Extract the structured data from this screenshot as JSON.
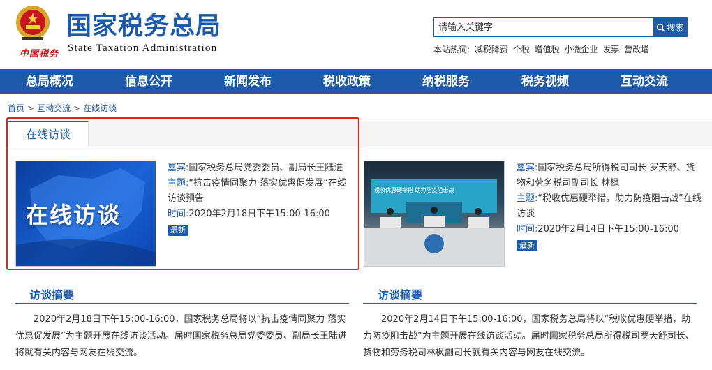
{
  "header": {
    "emblem_icon": "national-tax-emblem-icon",
    "china_tax_text": "中国税务",
    "title": "国家税务总局",
    "subtitle": "State Taxation Administration",
    "brand_color": "#1d5aa9"
  },
  "search": {
    "placeholder": "请输入关键字",
    "button_label": "搜索",
    "button_icon": "search-icon"
  },
  "hotwords": {
    "label": "本站热词:",
    "items": [
      "减税降费",
      "个税",
      "增值税",
      "小微企业",
      "发票",
      "营改增"
    ]
  },
  "nav": {
    "items": [
      "总局概况",
      "信息公开",
      "新闻发布",
      "税收政策",
      "纳税服务",
      "税务视频",
      "互动交流"
    ]
  },
  "breadcrumb": {
    "items": [
      "首页",
      "互动交流",
      "在线访谈"
    ],
    "separator": ">"
  },
  "tab": {
    "label": "在线访谈"
  },
  "interviews": [
    {
      "image_caption": "在线访谈",
      "guest_label": "嘉宾:",
      "guest": "国家税务总局党委委员、副局长王陆进",
      "topic_label": "主题:",
      "topic": "“抗击疫情同聚力 落实优惠促发展”在线访谈预告",
      "time_label": "时间:",
      "time": "2020年2月18日下午15:00-16:00",
      "badge": "最新",
      "summary_title": "访谈摘要",
      "summary": "2020年2月18日下午15:00-16:00，国家税务总局将以“抗击疫情同聚力 落实优惠促发展”为主题开展在线访谈活动。届时国家税务总局党委委员、副局长王陆进将就有关内容与网友在线交流。"
    },
    {
      "image_caption": "税收优惠硬举措 助力防疫阻击战",
      "guest_label": "嘉宾:",
      "guest": "国家税务总局所得税司司长 罗天舒、货物和劳务税司副司长 林枫",
      "topic_label": "主题:",
      "topic": "“税收优惠硬举措，助力防疫阻击战”在线访谈",
      "time_label": "时间:",
      "time": "2020年2月14日下午15:00-16:00",
      "badge": "最新",
      "summary_title": "访谈摘要",
      "summary": "2020年2月14日下午15:00-16:00，国家税务总局将以“税收优惠硬举措，助力防疫阻击战”为主题开展在线访谈活动。届时国家税务总局所得税司罗天舒司长、货物和劳务税司林枫副司长就有关内容与网友在线交流。"
    }
  ]
}
